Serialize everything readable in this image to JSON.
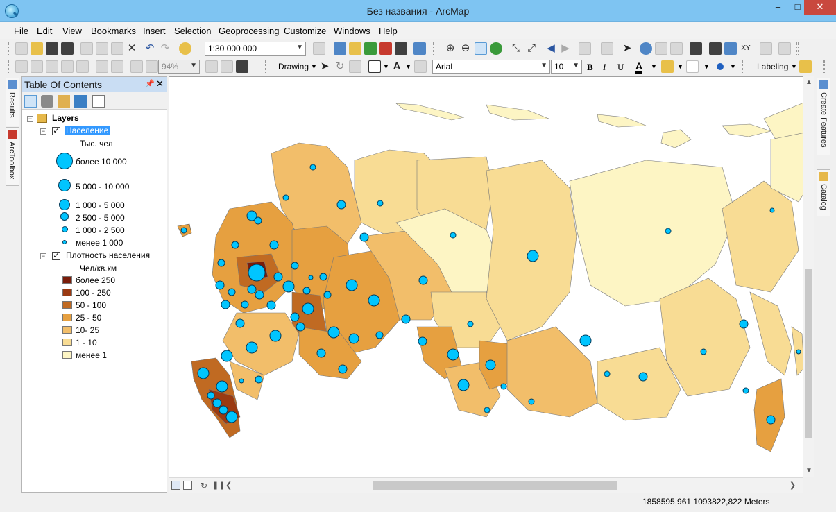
{
  "window": {
    "title": "Без названия - ArcMap",
    "minimize": "–",
    "maximize": "□",
    "close": "✕"
  },
  "menu": [
    "File",
    "Edit",
    "View",
    "Bookmarks",
    "Insert",
    "Selection",
    "Geoprocessing",
    "Customize",
    "Windows",
    "Help"
  ],
  "toolbar": {
    "scale": "1:30 000 000",
    "zoom_percent": "94%",
    "drawing_label": "Drawing",
    "font_name": "Arial",
    "font_size": "10",
    "bold": "B",
    "italic": "I",
    "underline": "U",
    "font_color_glyph": "A",
    "labeling_label": "Labeling"
  },
  "side_tabs": {
    "left": [
      "Results",
      "ArcToolbox"
    ],
    "right": [
      "Create Features",
      "Catalog"
    ]
  },
  "toc": {
    "title": "Table Of Contents",
    "root": "Layers",
    "layer1": {
      "name": "Население",
      "unit": "Тыс. чел",
      "classes": [
        "более 10 000",
        "5 000 - 10 000",
        "1 000 - 5 000",
        "2 500 - 5 000",
        "1 000 - 2 500",
        "менее 1 000"
      ]
    },
    "layer2": {
      "name": "Плотность населения",
      "unit": "Чел/кв.км",
      "classes": [
        "более 250",
        "100 - 250",
        "50 - 100",
        "25 - 50",
        "10- 25",
        "1 - 10",
        "менее 1"
      ],
      "colors": [
        "#7a1c0a",
        "#9a3a12",
        "#c06a22",
        "#e6a040",
        "#f2be6a",
        "#f8dc94",
        "#fdf5c4"
      ]
    }
  },
  "status": {
    "coordinates": "1858595,961  1093822,822 Meters"
  }
}
